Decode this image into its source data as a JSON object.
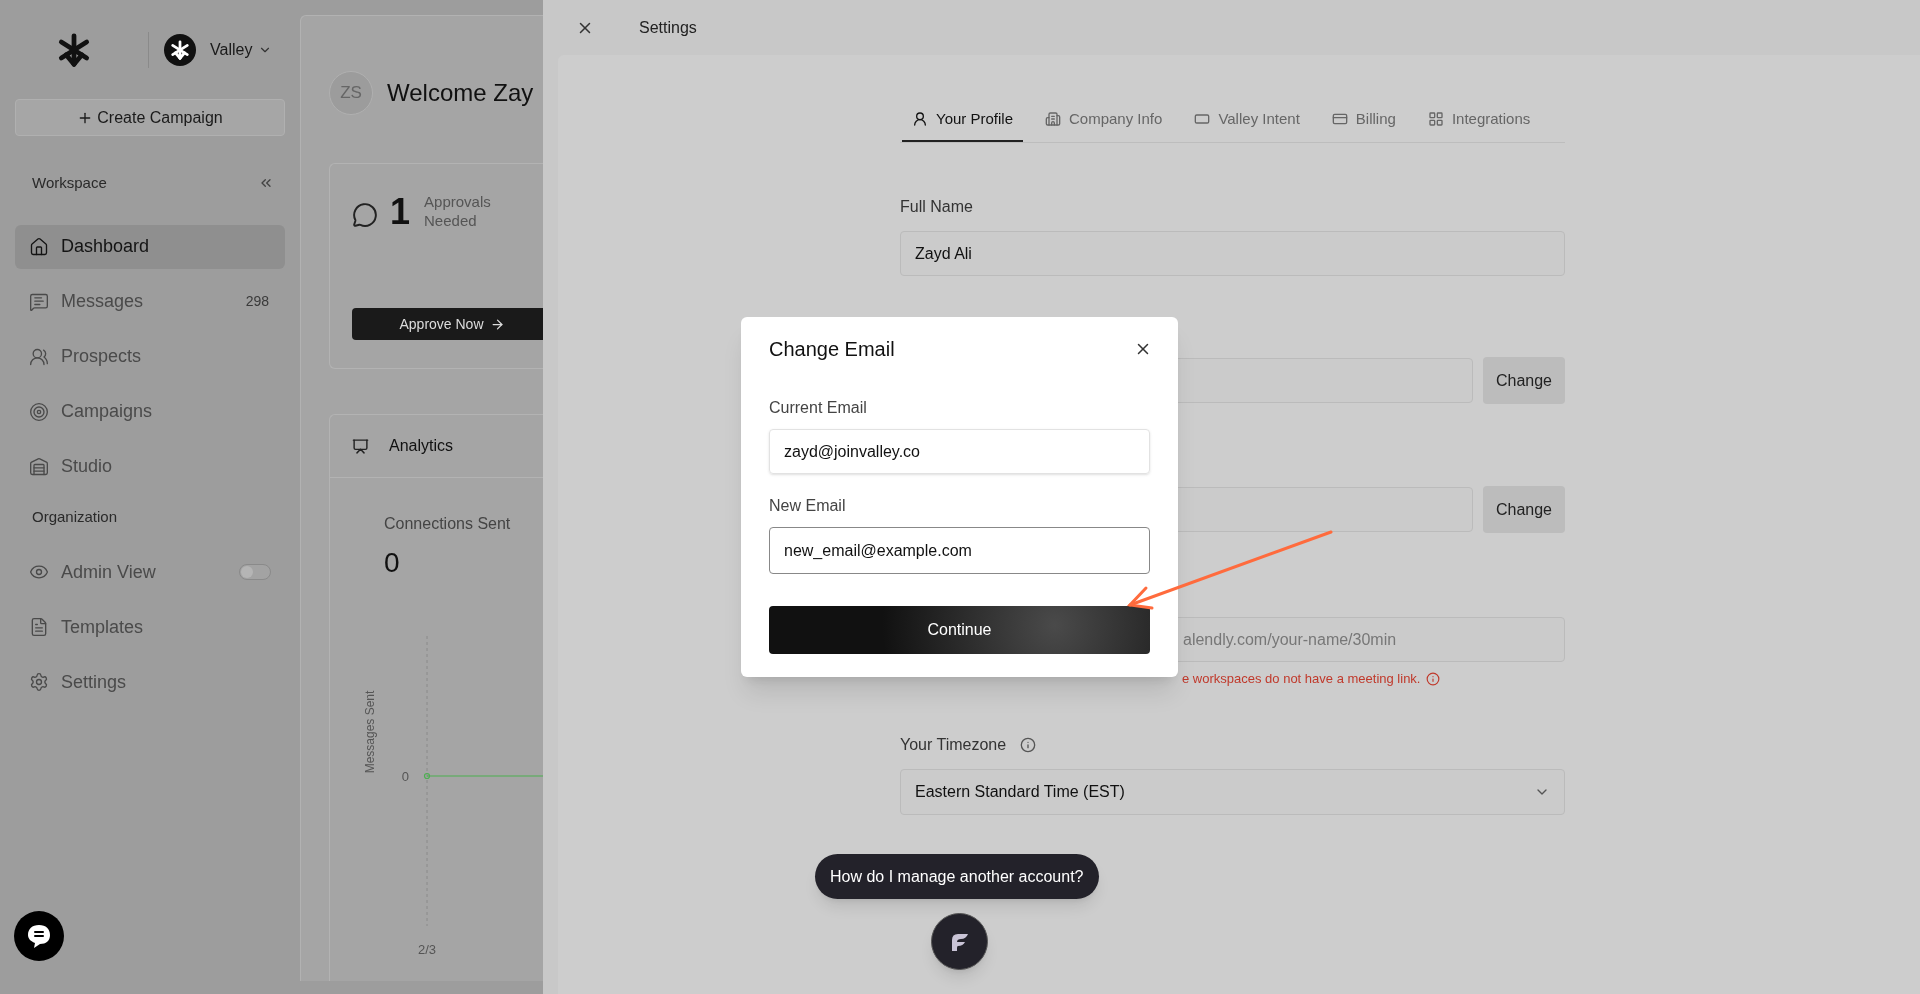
{
  "sidebar": {
    "workspace": {
      "name": "Valley"
    },
    "create_button": "Create Campaign",
    "sections": [
      {
        "title": "Workspace",
        "items": [
          {
            "label": "Dashboard",
            "selected": true,
            "kind": "link"
          },
          {
            "label": "Messages",
            "selected": false,
            "kind": "link",
            "count": "298"
          },
          {
            "label": "Prospects",
            "selected": false,
            "kind": "link"
          },
          {
            "label": "Campaigns",
            "selected": false,
            "kind": "link"
          },
          {
            "label": "Studio",
            "selected": false,
            "kind": "link"
          }
        ]
      },
      {
        "title": "Organization",
        "items": [
          {
            "label": "Admin View",
            "selected": false,
            "kind": "toggle",
            "on": false
          },
          {
            "label": "Templates",
            "selected": false,
            "kind": "link"
          },
          {
            "label": "Settings",
            "selected": false,
            "kind": "link"
          }
        ]
      }
    ]
  },
  "main": {
    "avatar": "ZS",
    "welcome": "Welcome Zay",
    "approvals": {
      "count": "1",
      "label": "Approvals Needed",
      "button": "Approve Now"
    },
    "analytics": {
      "title": "Analytics",
      "metric_label": "Connections Sent",
      "metric_value": "0",
      "chart": {
        "y_label": "Messages Sent",
        "y_tick": "0",
        "x_tick": "2/3"
      }
    }
  },
  "settings": {
    "title": "Settings",
    "tabs": [
      {
        "label": "Your Profile",
        "selected": true
      },
      {
        "label": "Company Info",
        "selected": false
      },
      {
        "label": "Valley Intent",
        "selected": false
      },
      {
        "label": "Billing",
        "selected": false
      },
      {
        "label": "Integrations",
        "selected": false
      }
    ],
    "full_name": {
      "label": "Full Name",
      "value": "Zayd Ali"
    },
    "change_buttons": [
      "Change",
      "Change"
    ],
    "meeting_link": {
      "placeholder": "alendly.com/your-name/30min",
      "error": "e workspaces do not have a meeting link."
    },
    "timezone": {
      "label": "Your Timezone",
      "value": "Eastern Standard Time (EST)"
    }
  },
  "modal": {
    "title": "Change Email",
    "current": {
      "label": "Current Email",
      "value": "zayd@joinvalley.co"
    },
    "new": {
      "label": "New Email",
      "value": "new_email@example.com"
    },
    "button": "Continue"
  },
  "assistant": {
    "prompt": "How do I manage another account?"
  }
}
